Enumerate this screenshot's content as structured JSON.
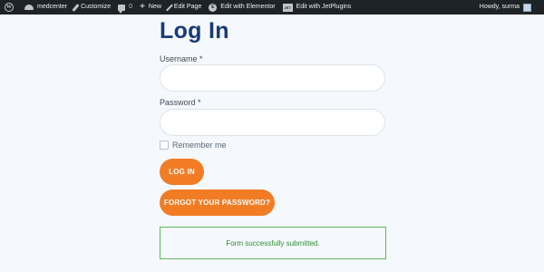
{
  "adminbar": {
    "site_name": "medcenter",
    "customize": "Customize",
    "comments_count": "0",
    "new": "New",
    "edit_page": "Edit Page",
    "edit_elementor": "Edit with Elementor",
    "edit_jet": "Edit with JetPlugins",
    "greeting": "Howdy, surma",
    "icons": [
      "wordpress-icon",
      "home-icon",
      "brush-icon",
      "comment-icon",
      "plus-icon",
      "pencil-icon",
      "elementor-icon",
      "jetplugins-icon"
    ]
  },
  "page": {
    "title": "Log In"
  },
  "form": {
    "username_label": "Username *",
    "username_value": "",
    "password_label": "Password *",
    "password_value": "",
    "remember_label": "Remember me",
    "remember_checked": false,
    "login_button": "LOG IN",
    "forgot_button": "FORGOT YOUR PASSWORD?"
  },
  "message": {
    "success": "Form successfully submitted."
  },
  "colors": {
    "adminbar_bg": "#1d2327",
    "title": "#1a3a78",
    "button": "#f27c24",
    "success_border": "#5cb85c",
    "success_text": "#2e8b2e",
    "page_bg": "#f5f9fd"
  }
}
